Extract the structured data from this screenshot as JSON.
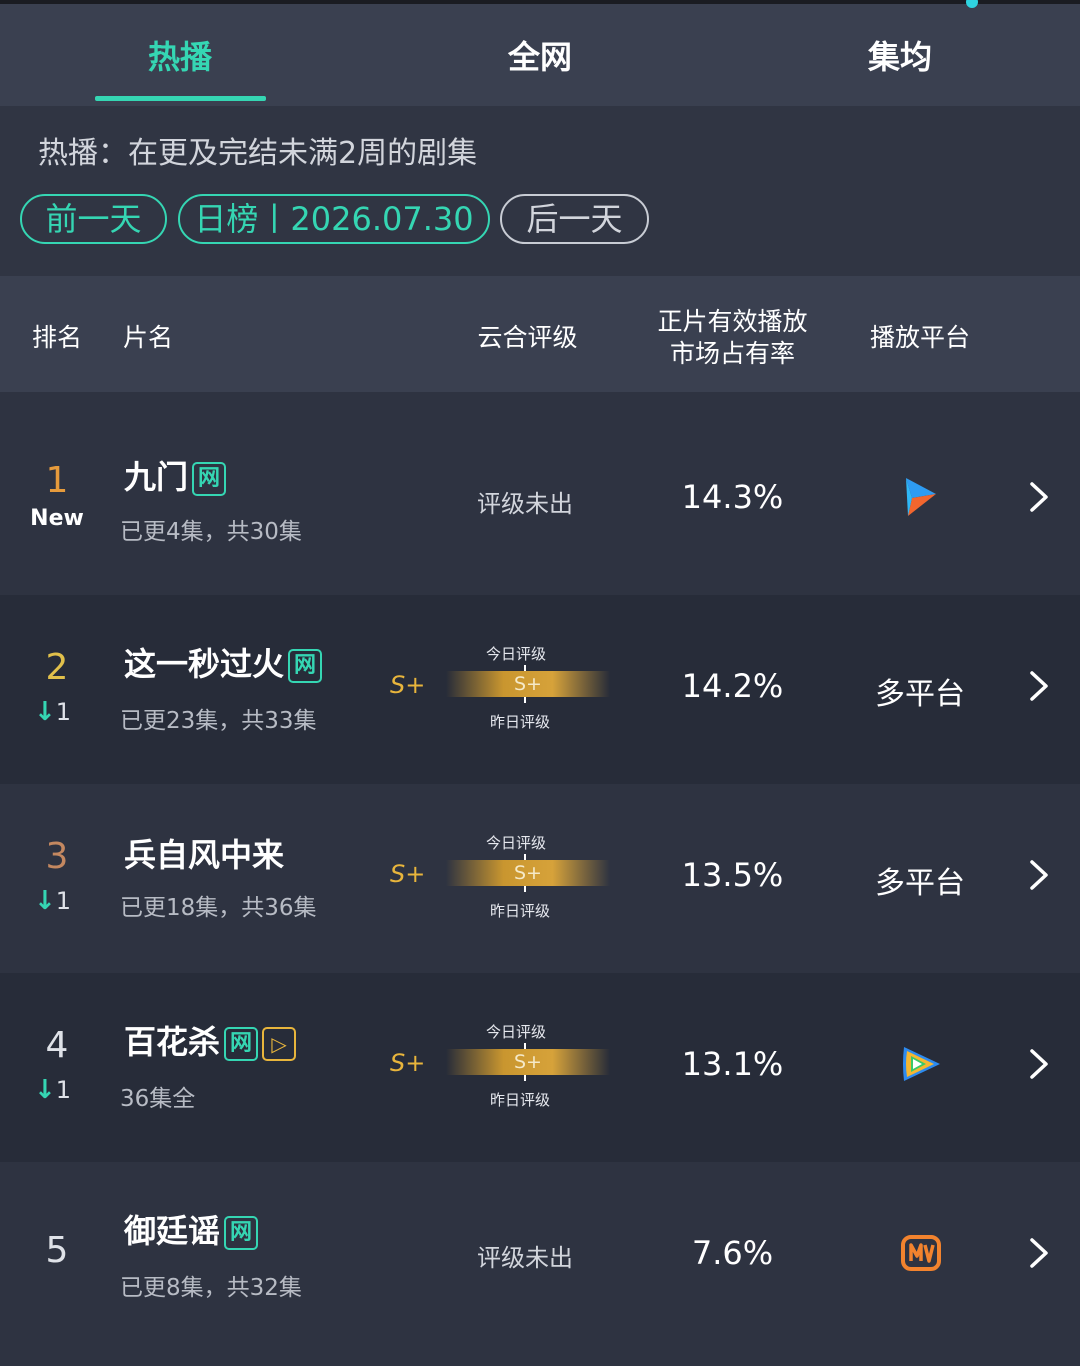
{
  "tabs": [
    {
      "label": "热播",
      "active": true
    },
    {
      "label": "全网",
      "active": false
    },
    {
      "label": "集均",
      "active": false
    }
  ],
  "filter": {
    "description": "热播：在更及完结未满2周的剧集",
    "prev_label": "前一天",
    "date_label": "日榜丨2026.07.30",
    "next_label": "后一天"
  },
  "table_header": {
    "rank": "排名",
    "title": "片名",
    "rating": "云合评级",
    "share_line1": "正片有效播放",
    "share_line2": "市场占有率",
    "platform": "播放平台"
  },
  "rows": [
    {
      "rank": "1",
      "change": "New",
      "title": "九门",
      "badges": [
        "网"
      ],
      "episodes": "已更4集，共30集",
      "rating": "评级未出",
      "share": "14.3%",
      "platform_icon": "youku-icon",
      "platform_text": ""
    },
    {
      "rank": "2",
      "change": "1",
      "title": "这一秒过火",
      "badges": [
        "网"
      ],
      "episodes": "已更23集，共33集",
      "rating_grade": "S+",
      "today_label": "今日评级",
      "bar_grade": "S+",
      "yesterday_label": "昨日评级",
      "share": "14.2%",
      "platform_text": "多平台"
    },
    {
      "rank": "3",
      "change": "1",
      "title": "兵自风中来",
      "badges": [],
      "episodes": "已更18集，共36集",
      "rating_grade": "S+",
      "today_label": "今日评级",
      "bar_grade": "S+",
      "yesterday_label": "昨日评级",
      "share": "13.5%",
      "platform_text": "多平台"
    },
    {
      "rank": "4",
      "change": "1",
      "title": "百花杀",
      "badges": [
        "网",
        "▷"
      ],
      "episodes": "36集全",
      "rating_grade": "S+",
      "today_label": "今日评级",
      "bar_grade": "S+",
      "yesterday_label": "昨日评级",
      "share": "13.1%",
      "platform_icon": "tencent-video-icon",
      "platform_text": ""
    },
    {
      "rank": "5",
      "change": "",
      "title": "御廷谣",
      "badges": [
        "网"
      ],
      "episodes": "已更8集，共32集",
      "rating": "评级未出",
      "share": "7.6%",
      "platform_icon": "mango-tv-icon",
      "platform_text": ""
    }
  ],
  "colors": {
    "accent": "#35d6b3",
    "grade": "#e8b53c",
    "background": "#252a37"
  }
}
